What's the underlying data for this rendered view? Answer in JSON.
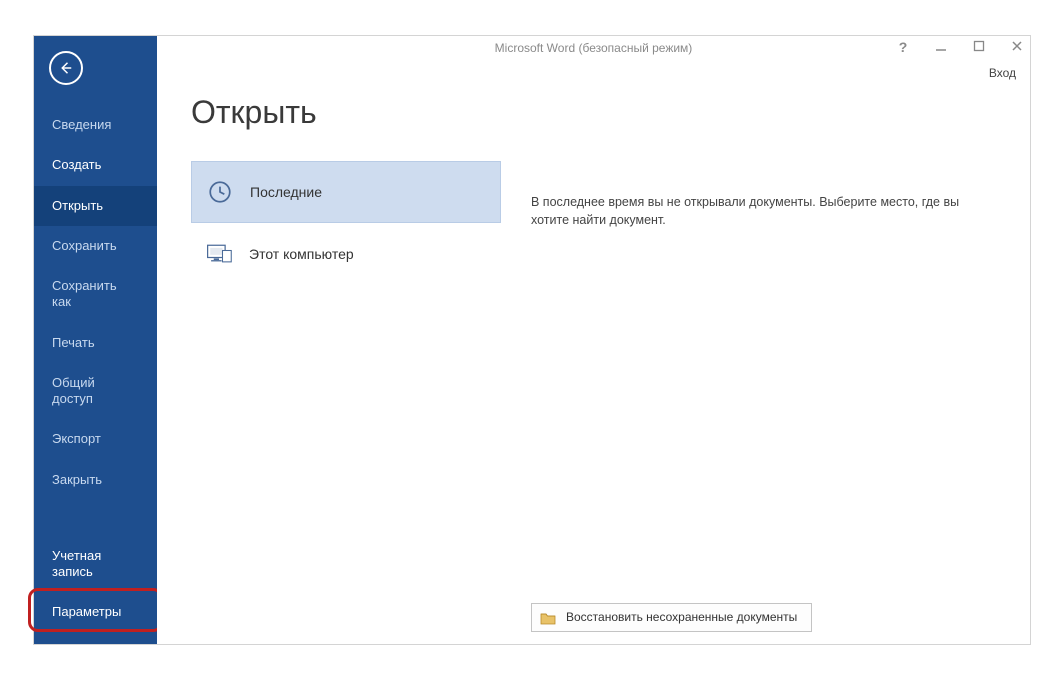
{
  "titlebar": {
    "title": "Microsoft Word (безопасный режим)",
    "signin": "Вход"
  },
  "sidebar": {
    "items": [
      {
        "label": "Сведения",
        "state": "disabled"
      },
      {
        "label": "Создать",
        "state": "enabled"
      },
      {
        "label": "Открыть",
        "state": "active"
      },
      {
        "label": "Сохранить",
        "state": "disabled"
      },
      {
        "label": "Сохранить как",
        "state": "disabled"
      },
      {
        "label": "Печать",
        "state": "disabled"
      },
      {
        "label": "Общий доступ",
        "state": "disabled"
      },
      {
        "label": "Экспорт",
        "state": "disabled"
      },
      {
        "label": "Закрыть",
        "state": "disabled"
      }
    ],
    "account": "Учетная запись",
    "options": "Параметры"
  },
  "page": {
    "title": "Открыть",
    "locations": [
      {
        "label": "Последние",
        "icon": "clock",
        "selected": true
      },
      {
        "label": "Этот компьютер",
        "icon": "computer",
        "selected": false
      }
    ],
    "message": "В последнее время вы не открывали документы. Выберите место, где вы хотите найти документ.",
    "recover": "Восстановить несохраненные документы"
  }
}
